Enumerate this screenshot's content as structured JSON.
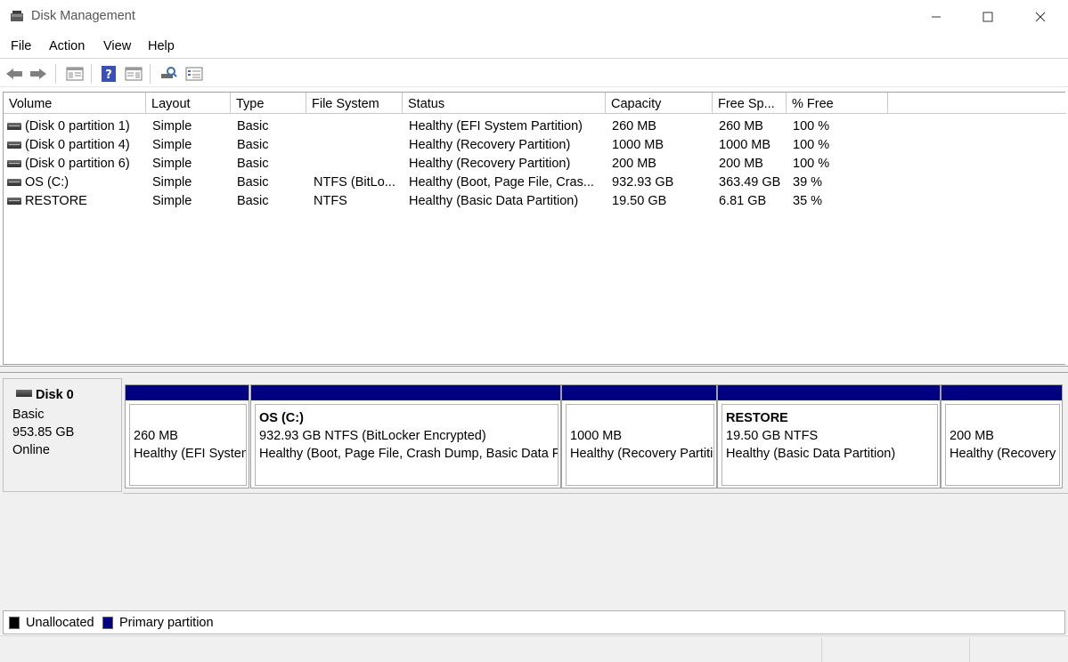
{
  "window": {
    "title": "Disk Management",
    "app_icon": "disk-management-icon"
  },
  "menu": {
    "items": [
      "File",
      "Action",
      "View",
      "Help"
    ]
  },
  "toolbar": {
    "icons": [
      "back-arrow-icon",
      "forward-arrow-icon",
      "show-hide-console-tree-icon",
      "help-icon",
      "properties-icon",
      "rescan-disks-icon",
      "disk-list-icon"
    ]
  },
  "volume_list": {
    "columns": [
      "Volume",
      "Layout",
      "Type",
      "File System",
      "Status",
      "Capacity",
      "Free Sp...",
      "% Free"
    ],
    "rows": [
      {
        "volume": "(Disk 0 partition 1)",
        "layout": "Simple",
        "type": "Basic",
        "fs": "",
        "status": "Healthy (EFI System Partition)",
        "capacity": "260 MB",
        "free": "260 MB",
        "pct": "100 %"
      },
      {
        "volume": "(Disk 0 partition 4)",
        "layout": "Simple",
        "type": "Basic",
        "fs": "",
        "status": "Healthy (Recovery Partition)",
        "capacity": "1000 MB",
        "free": "1000 MB",
        "pct": "100 %"
      },
      {
        "volume": "(Disk 0 partition 6)",
        "layout": "Simple",
        "type": "Basic",
        "fs": "",
        "status": "Healthy (Recovery Partition)",
        "capacity": "200 MB",
        "free": "200 MB",
        "pct": "100 %"
      },
      {
        "volume": "OS (C:)",
        "layout": "Simple",
        "type": "Basic",
        "fs": "NTFS (BitLo...",
        "status": "Healthy (Boot, Page File, Cras...",
        "capacity": "932.93 GB",
        "free": "363.49 GB",
        "pct": "39 %"
      },
      {
        "volume": "RESTORE",
        "layout": "Simple",
        "type": "Basic",
        "fs": "NTFS",
        "status": "Healthy (Basic Data Partition)",
        "capacity": "19.50 GB",
        "free": "6.81 GB",
        "pct": "35 %"
      }
    ]
  },
  "disk": {
    "name": "Disk 0",
    "type": "Basic",
    "size": "953.85 GB",
    "state": "Online",
    "partitions": [
      {
        "title": "",
        "line1": "260 MB",
        "line2": "Healthy (EFI System Partition)"
      },
      {
        "title": "OS  (C:)",
        "line1": "932.93 GB NTFS (BitLocker Encrypted)",
        "line2": "Healthy (Boot, Page File, Crash Dump, Basic Data Partition)"
      },
      {
        "title": "",
        "line1": "1000 MB",
        "line2": "Healthy (Recovery Partition)"
      },
      {
        "title": "RESTORE",
        "line1": "19.50 GB NTFS",
        "line2": "Healthy (Basic Data Partition)"
      },
      {
        "title": "",
        "line1": "200 MB",
        "line2": "Healthy (Recovery Partition)"
      }
    ]
  },
  "legend": {
    "items": [
      {
        "label": "Unallocated",
        "color": "#000000"
      },
      {
        "label": "Primary partition",
        "color": "#000080"
      }
    ]
  }
}
